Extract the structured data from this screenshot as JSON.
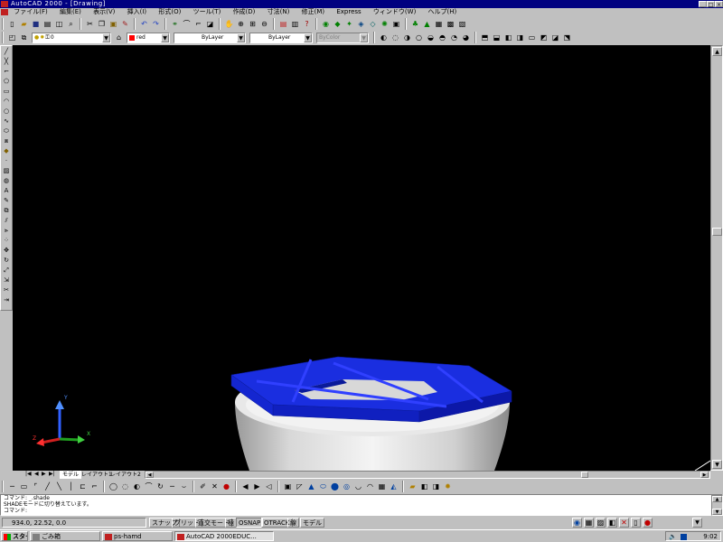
{
  "window": {
    "title": "AutoCAD 2000 - [Drawing]",
    "controls": [
      "_",
      "□",
      "×"
    ]
  },
  "menubar": {
    "items": [
      "ファイル(F)",
      "編集(E)",
      "表示(V)",
      "挿入(I)",
      "形式(O)",
      "ツール(T)",
      "作成(D)",
      "寸法(N)",
      "修正(M)",
      "Express",
      "ウィンドウ(W)",
      "ヘルプ(H)"
    ]
  },
  "properties": {
    "layer": "0",
    "color": "red",
    "linetype": "ByLayer",
    "lineweight": "ByLayer",
    "plotstyle": "ByColor"
  },
  "layout_tabs": [
    "モデル",
    "レイアウト1",
    "レイアウト2"
  ],
  "command": {
    "lines": [
      "コマンド: _.shade",
      "SHADEモードに切り替えています。",
      "コマンド:"
    ]
  },
  "status": {
    "coords": "934.0, 22.52, 0.0",
    "buttons": [
      "スナップ",
      "グリッド",
      "直交モード",
      "極",
      "OSNAP",
      "OTRACK",
      "線",
      "モデル"
    ]
  },
  "taskbar": {
    "start_label": "スタート",
    "tasks": [
      "ごみ箱",
      "ps-hamd",
      "AutoCAD 2000EDUC..."
    ],
    "clock": "9:02"
  },
  "colors": {
    "titlebar": "#000080",
    "viewport_bg": "#000000",
    "object_blue": "#1a2ee0",
    "cylinder": "#d8d8d8"
  },
  "ucs_icon": {
    "labels": [
      "Y",
      "X",
      "Z"
    ]
  }
}
